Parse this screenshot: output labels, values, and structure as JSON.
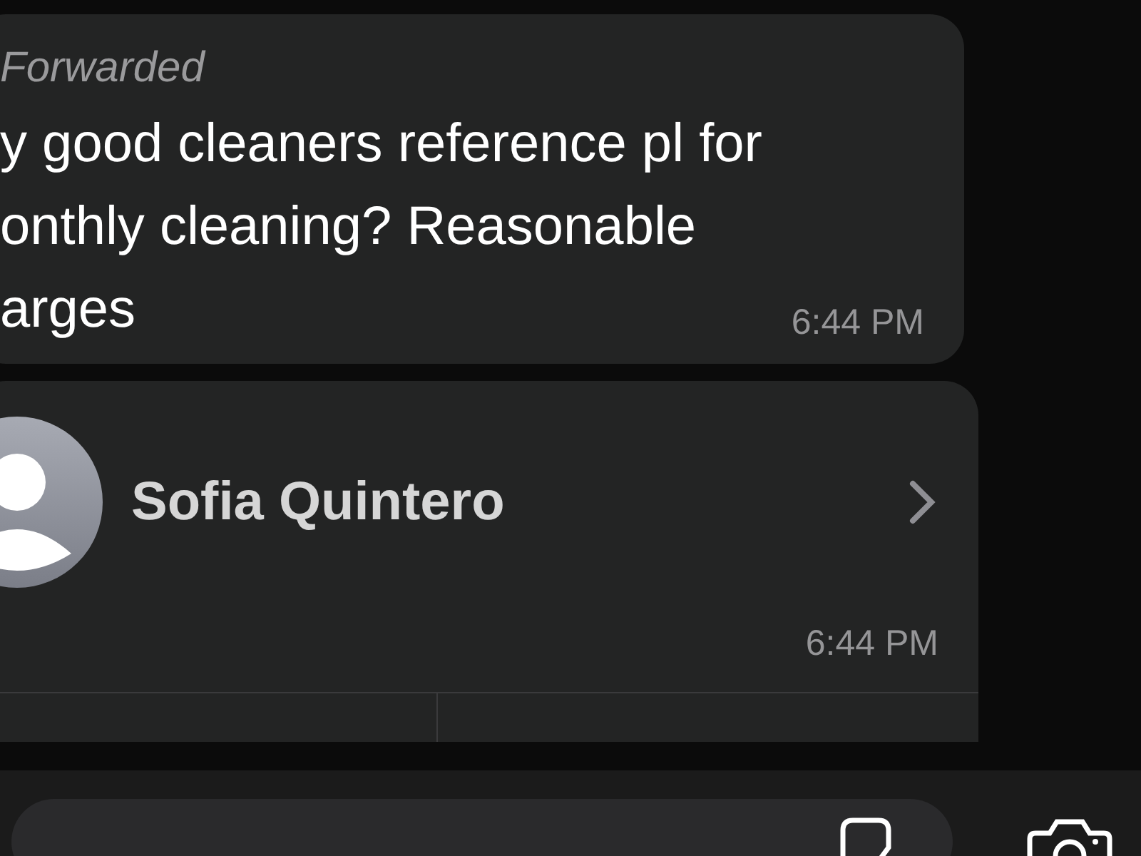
{
  "messages": [
    {
      "kind": "forwarded-text",
      "forwarded_label": "Forwarded",
      "lines": [
        "y good cleaners reference pl for",
        "onthly cleaning? Reasonable",
        "arges"
      ],
      "time": "6:44 PM"
    },
    {
      "kind": "contact",
      "name": "Sofia Quintero",
      "time": "6:44 PM"
    }
  ]
}
